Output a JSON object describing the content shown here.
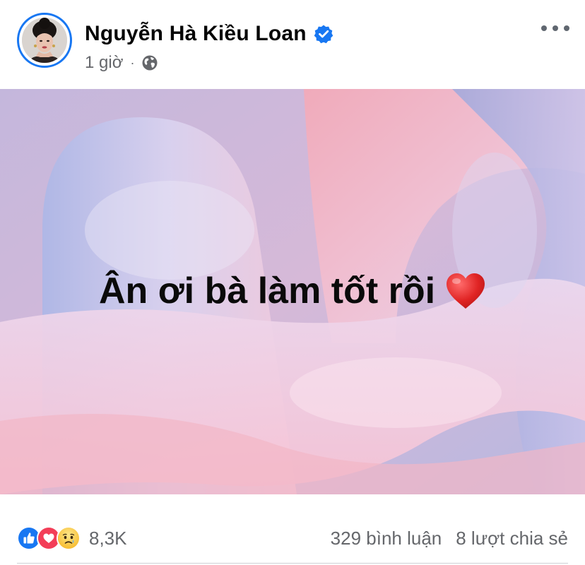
{
  "author": {
    "name": "Nguyễn Hà Kiều Loan",
    "verified": true,
    "avatar": "avatar-photo"
  },
  "meta": {
    "time": "1 giờ",
    "separator": "·",
    "privacy_icon": "globe-icon"
  },
  "menu": {
    "icon": "more-horizontal-icon"
  },
  "post": {
    "text": "Ân ơi bà làm tốt rồi",
    "emoji": "red-heart-icon",
    "background": {
      "style": "pink-lavender-swirl",
      "colors": [
        "#f2aab8",
        "#b8c0e6",
        "#e9cfe6",
        "#9fa9dc"
      ]
    }
  },
  "reactions": {
    "icons": [
      "like-icon",
      "love-icon",
      "sad-icon"
    ],
    "count": "8,3K",
    "colors": {
      "like": "#1877f2",
      "love": "#f33e58",
      "sad": "#f7b928"
    }
  },
  "stats": {
    "comments": "329 bình luận",
    "shares": "8 lượt chia sẻ"
  }
}
